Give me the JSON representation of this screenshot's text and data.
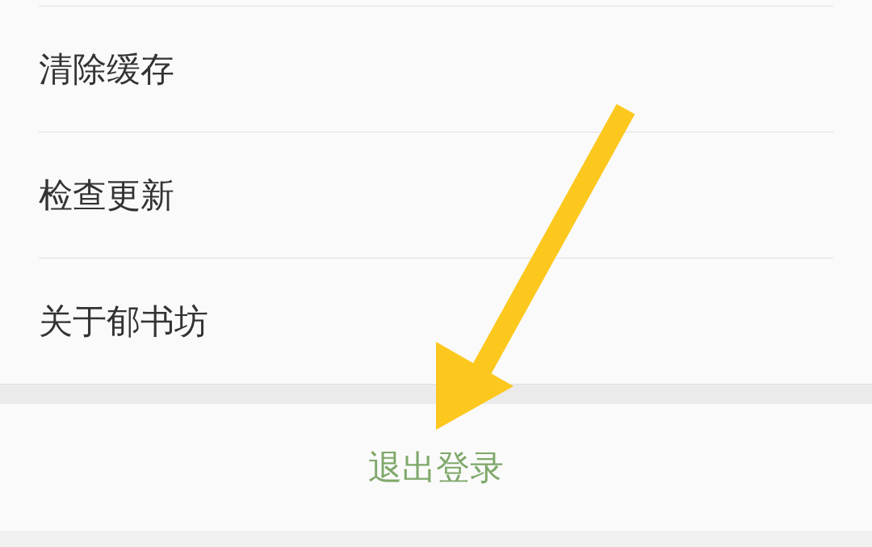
{
  "settings_items": [
    {
      "label": "清除缓存"
    },
    {
      "label": "检查更新"
    },
    {
      "label": "关于郁书坊"
    }
  ],
  "logout_button": {
    "label": "退出登录"
  }
}
